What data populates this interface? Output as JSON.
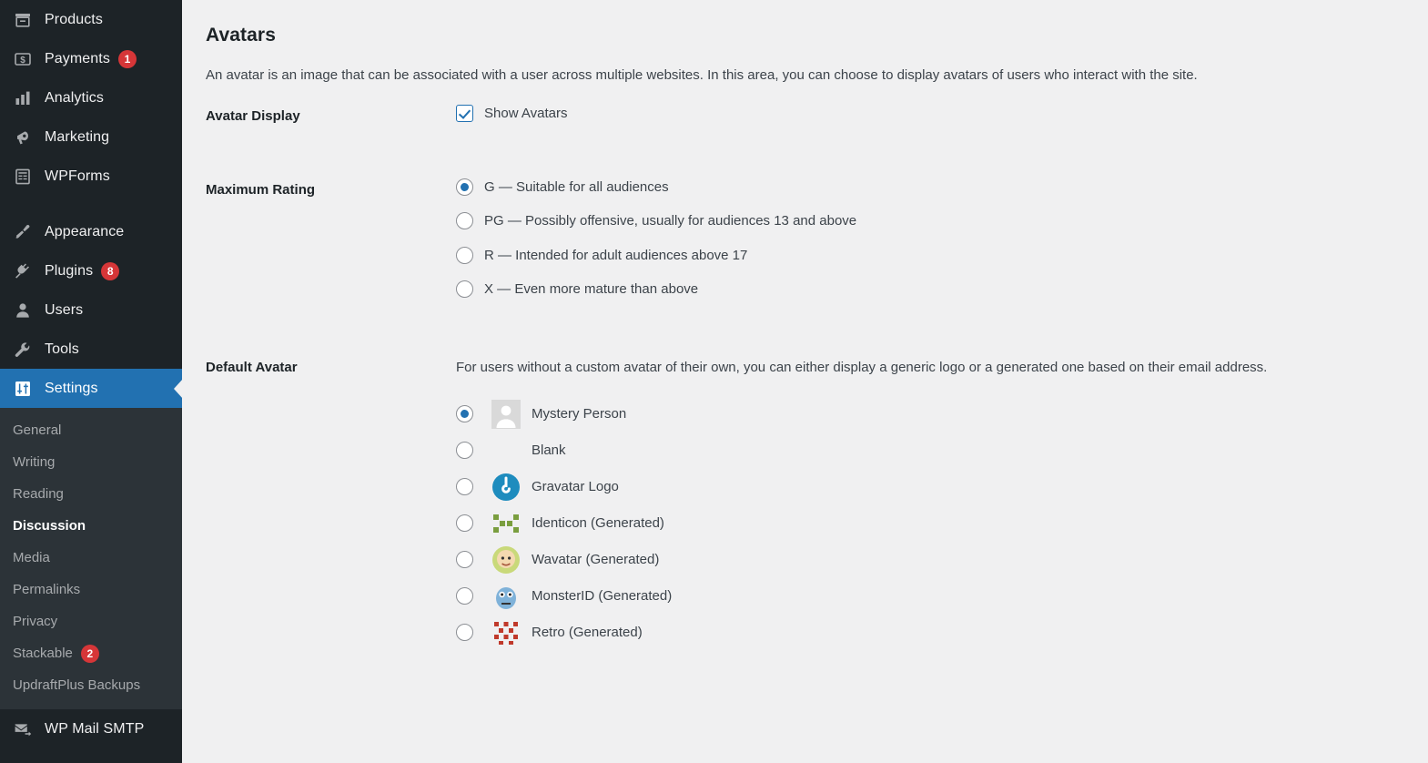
{
  "sidebar": {
    "primary_items": [
      {
        "label": "Products",
        "icon": "products-icon",
        "badge": null,
        "active": false
      },
      {
        "label": "Payments",
        "icon": "payments-icon",
        "badge": "1",
        "active": false
      },
      {
        "label": "Analytics",
        "icon": "analytics-icon",
        "badge": null,
        "active": false
      },
      {
        "label": "Marketing",
        "icon": "megaphone-icon",
        "badge": null,
        "active": false
      },
      {
        "label": "WPForms",
        "icon": "wpforms-icon",
        "badge": null,
        "active": false
      }
    ],
    "secondary_items": [
      {
        "label": "Appearance",
        "icon": "paintbrush-icon",
        "badge": null,
        "active": false
      },
      {
        "label": "Plugins",
        "icon": "plug-icon",
        "badge": "8",
        "active": false
      },
      {
        "label": "Users",
        "icon": "user-icon",
        "badge": null,
        "active": false
      },
      {
        "label": "Tools",
        "icon": "wrench-icon",
        "badge": null,
        "active": false
      },
      {
        "label": "Settings",
        "icon": "settings-icon",
        "badge": null,
        "active": true
      }
    ],
    "submenu_items": [
      {
        "label": "General",
        "current": false,
        "badge": null
      },
      {
        "label": "Writing",
        "current": false,
        "badge": null
      },
      {
        "label": "Reading",
        "current": false,
        "badge": null
      },
      {
        "label": "Discussion",
        "current": true,
        "badge": null
      },
      {
        "label": "Media",
        "current": false,
        "badge": null
      },
      {
        "label": "Permalinks",
        "current": false,
        "badge": null
      },
      {
        "label": "Privacy",
        "current": false,
        "badge": null
      },
      {
        "label": "Stackable",
        "current": false,
        "badge": "2"
      },
      {
        "label": "UpdraftPlus Backups",
        "current": false,
        "badge": null
      }
    ],
    "bottom_items": [
      {
        "label": "WP Mail SMTP",
        "icon": "mail-send-icon",
        "badge": null,
        "active": false
      }
    ],
    "colors": {
      "background": "#1d2327",
      "submenu_background": "#2c3338",
      "active_background": "#2271b1",
      "badge_background": "#d63638",
      "text": "#f0f0f1",
      "muted_text": "#a7aaad"
    }
  },
  "main": {
    "title": "Avatars",
    "description": "An avatar is an image that can be associated with a user across multiple websites. In this area, you can choose to display avatars of users who interact with the site.",
    "avatar_display": {
      "label": "Avatar Display",
      "checkbox_label": "Show Avatars",
      "checked": true
    },
    "maximum_rating": {
      "label": "Maximum Rating",
      "selected": "G",
      "options": [
        {
          "value": "G",
          "label": "G — Suitable for all audiences",
          "checked": true
        },
        {
          "value": "PG",
          "label": "PG — Possibly offensive, usually for audiences 13 and above",
          "checked": false
        },
        {
          "value": "R",
          "label": "R — Intended for adult audiences above 17",
          "checked": false
        },
        {
          "value": "X",
          "label": "X — Even more mature than above",
          "checked": false
        }
      ]
    },
    "default_avatar": {
      "label": "Default Avatar",
      "description": "For users without a custom avatar of their own, you can either display a generic logo or a generated one based on their email address.",
      "selected": "Mystery Person",
      "options": [
        {
          "label": "Mystery Person",
          "checked": true
        },
        {
          "label": "Blank",
          "checked": false
        },
        {
          "label": "Gravatar Logo",
          "checked": false
        },
        {
          "label": "Identicon (Generated)",
          "checked": false
        },
        {
          "label": "Wavatar (Generated)",
          "checked": false
        },
        {
          "label": "MonsterID (Generated)",
          "checked": false
        },
        {
          "label": "Retro (Generated)",
          "checked": false
        }
      ]
    },
    "colors": {
      "accent": "#2271b1",
      "background": "#f0f0f1",
      "heading": "#1d2327",
      "body_text": "#3c434a"
    }
  }
}
